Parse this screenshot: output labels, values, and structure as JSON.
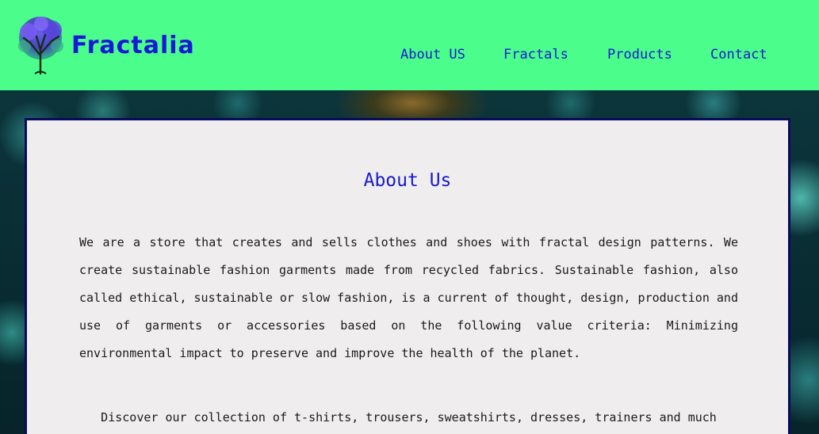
{
  "brand": {
    "name": "Fractalia",
    "logo_icon": "fractal-tree-icon"
  },
  "nav": {
    "items": [
      {
        "label": "About US"
      },
      {
        "label": "Fractals"
      },
      {
        "label": "Products"
      },
      {
        "label": "Contact"
      }
    ]
  },
  "about": {
    "title": "About Us",
    "paragraph": "We are a store that creates and sells clothes and shoes with fractal design patterns. We create sustainable fashion garments made from recycled fabrics. Sustainable fashion, also called ethical, sustainable or slow fashion, is a current of thought, design, production and use of garments or accessories based on the following value criteria: Minimizing environmental impact to preserve and improve the health of the planet.",
    "paragraph2": "Discover our collection of t-shirts, trousers, sweatshirts, dresses, trainers and much"
  },
  "colors": {
    "header_bg": "#4bfd8a",
    "accent": "#1a1ad0",
    "card_bg": "#efedee",
    "card_border": "#0a0a5e"
  }
}
